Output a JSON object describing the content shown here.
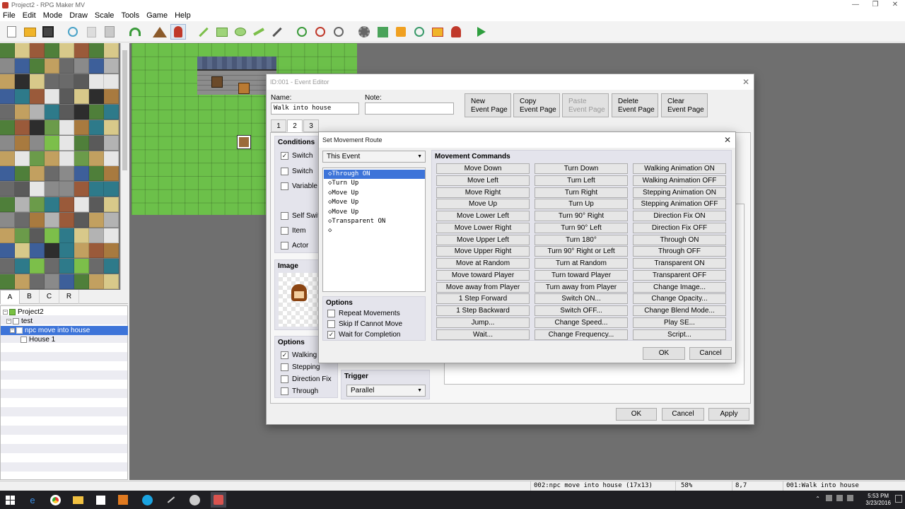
{
  "window": {
    "title": "Project2 - RPG Maker MV",
    "controls": [
      "—",
      "❐",
      "✕"
    ]
  },
  "menu": [
    "File",
    "Edit",
    "Mode",
    "Draw",
    "Scale",
    "Tools",
    "Game",
    "Help"
  ],
  "tileset_tabs": [
    "A",
    "B",
    "C",
    "R"
  ],
  "map_tree": {
    "project": "Project2",
    "map": "test",
    "event_item": "npc move into house",
    "child": "House 1"
  },
  "event_editor": {
    "title": "ID:001 - Event Editor",
    "name_label": "Name:",
    "name_value": "Walk into house",
    "note_label": "Note:",
    "note_value": "",
    "page_buttons": [
      {
        "line1": "New",
        "line2": "Event Page"
      },
      {
        "line1": "Copy",
        "line2": "Event Page"
      },
      {
        "line1": "Paste",
        "line2": "Event Page"
      },
      {
        "line1": "Delete",
        "line2": "Event Page"
      },
      {
        "line1": "Clear",
        "line2": "Event Page"
      }
    ],
    "tabs": [
      "1",
      "2",
      "3"
    ],
    "conditions": {
      "title": "Conditions",
      "items": [
        "Switch",
        "Switch",
        "Variable",
        "Self Switch",
        "Item",
        "Actor"
      ]
    },
    "image_title": "Image",
    "options": {
      "title": "Options",
      "items": [
        "Walking",
        "Stepping",
        "Direction Fix",
        "Through"
      ]
    },
    "trigger": {
      "title": "Trigger",
      "value": "Parallel"
    },
    "buttons": {
      "ok": "OK",
      "cancel": "Cancel",
      "apply": "Apply"
    }
  },
  "move_route": {
    "title": "Set Movement Route",
    "target": "This Event",
    "route": [
      "◇Through ON",
      "◇Turn Up",
      "◇Move Up",
      "◇Move Up",
      "◇Move Up",
      "◇Transparent ON",
      "◇"
    ],
    "options": {
      "title": "Options",
      "items": [
        {
          "label": "Repeat Movements",
          "checked": false
        },
        {
          "label": "Skip If Cannot Move",
          "checked": false
        },
        {
          "label": "Wait for Completion",
          "checked": true
        }
      ]
    },
    "commands_title": "Movement Commands",
    "commands": [
      [
        "Move Down",
        "Move Left",
        "Move Right",
        "Move Up",
        "Move Lower Left",
        "Move Lower Right",
        "Move Upper Left",
        "Move Upper Right",
        "Move at Random",
        "Move toward Player",
        "Move away from Player",
        "1 Step Forward",
        "1 Step Backward",
        "Jump...",
        "Wait..."
      ],
      [
        "Turn Down",
        "Turn Left",
        "Turn Right",
        "Turn Up",
        "Turn 90° Right",
        "Turn 90° Left",
        "Turn 180°",
        "Turn 90° Right or Left",
        "Turn at Random",
        "Turn toward Player",
        "Turn away from Player",
        "Switch ON...",
        "Switch OFF...",
        "Change Speed...",
        "Change Frequency..."
      ],
      [
        "Walking Animation ON",
        "Walking Animation OFF",
        "Stepping Animation ON",
        "Stepping Animation OFF",
        "Direction Fix ON",
        "Direction Fix OFF",
        "Through ON",
        "Through OFF",
        "Transparent ON",
        "Transparent OFF",
        "Change Image...",
        "Change Opacity...",
        "Change Blend Mode...",
        "Play SE...",
        "Script..."
      ]
    ],
    "ok": "OK",
    "cancel": "Cancel"
  },
  "status": {
    "map": "002:npc move into house (17x13)",
    "zoom": "58%",
    "coords": "8,7",
    "event": "001:Walk into house"
  },
  "taskbar": {
    "time": "5:53 PM",
    "date": "3/23/2016"
  }
}
